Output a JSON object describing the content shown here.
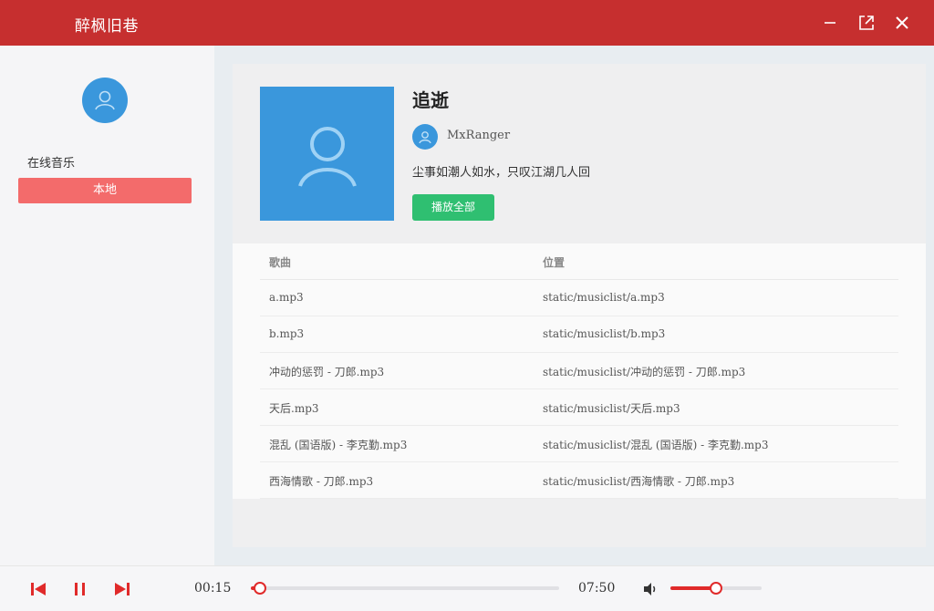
{
  "app": {
    "title": "醉枫旧巷"
  },
  "colors": {
    "brand": "#c62f2f",
    "accent": "#e02a2a",
    "active_item": "#f36b6b",
    "play_all": "#2fbf71",
    "avatar": "#3a97dc"
  },
  "sidebar": {
    "section_label": "在线音乐",
    "items": [
      {
        "label": "本地",
        "active": true
      }
    ]
  },
  "playlist": {
    "title": "追逝",
    "creator": "MxRanger",
    "description": "尘事如潮人如水，只叹江湖几人回",
    "play_all_label": "播放全部",
    "columns": {
      "song": "歌曲",
      "location": "位置"
    },
    "rows": [
      {
        "song": "a.mp3",
        "location": "static/musiclist/a.mp3"
      },
      {
        "song": "b.mp3",
        "location": "static/musiclist/b.mp3"
      },
      {
        "song": "冲动的惩罚 - 刀郎.mp3",
        "location": "static/musiclist/冲动的惩罚 - 刀郎.mp3"
      },
      {
        "song": "天后.mp3",
        "location": "static/musiclist/天后.mp3"
      },
      {
        "song": "混乱 (国语版) - 李克勤.mp3",
        "location": "static/musiclist/混乱 (国语版) - 李克勤.mp3"
      },
      {
        "song": "西海情歌 - 刀郎.mp3",
        "location": "static/musiclist/西海情歌 - 刀郎.mp3"
      }
    ]
  },
  "player": {
    "current_time": "00:15",
    "total_time": "07:50",
    "progress": 0.03,
    "volume": 0.5,
    "icons": [
      "prev-icon",
      "pause-icon",
      "next-icon",
      "volume-icon"
    ]
  }
}
